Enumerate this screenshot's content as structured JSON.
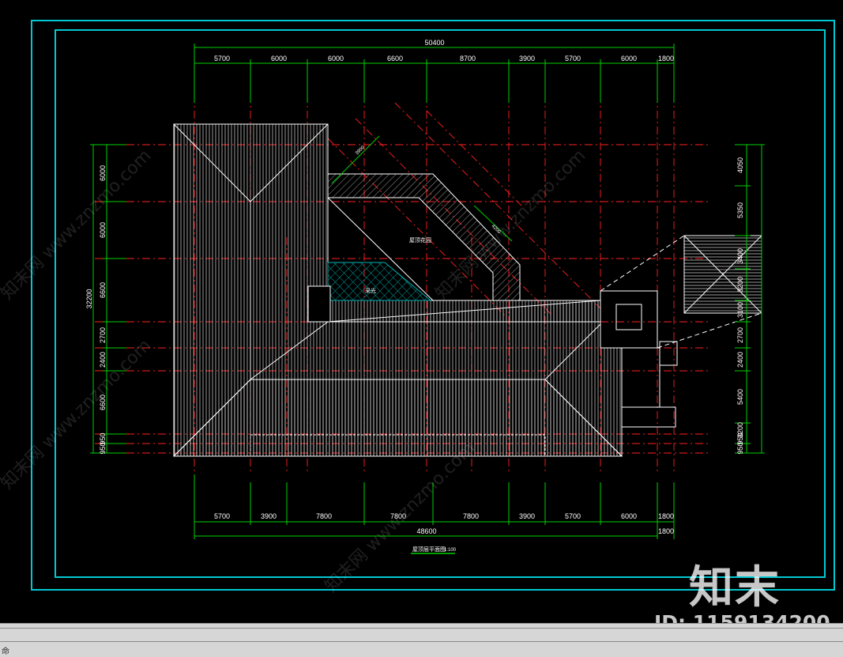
{
  "drawing": {
    "title": "屋顶层平面图",
    "scale": "1:100",
    "top_total": "50400",
    "top_dims": [
      "5700",
      "6000",
      "6000",
      "6600",
      "8700",
      "3900",
      "5700",
      "6000",
      "1800"
    ],
    "bottom_dims": [
      "5700",
      "3900",
      "7800",
      "7800",
      "7800",
      "3900",
      "5700",
      "6000",
      "1800"
    ],
    "bottom_total": "48600",
    "bottom_extra": "1800",
    "left_total": "32200",
    "left_dims": [
      "6000",
      "6000",
      "6600",
      "2700",
      "2400",
      "6600",
      "950",
      "950"
    ],
    "right_dims": [
      "4050",
      "5350",
      "3400",
      "3200",
      "3100",
      "2700",
      "2400",
      "5400",
      "3200",
      "950",
      "950"
    ],
    "room_labels": {
      "garden": "屋顶花园",
      "skylight": "采光"
    },
    "diag_dims": [
      "3900",
      "4200"
    ],
    "watermark_text": "知末网 www.znzmo.com"
  },
  "watermark": {
    "logo": "知末",
    "id": "ID: 1159134200"
  },
  "statusbar": {
    "text": "命"
  },
  "colors": {
    "frame": "#00c8d2",
    "dim": "#00d000",
    "axis": "#ff2020",
    "roof": "#ffffff",
    "hatch": "#00b0b0"
  }
}
